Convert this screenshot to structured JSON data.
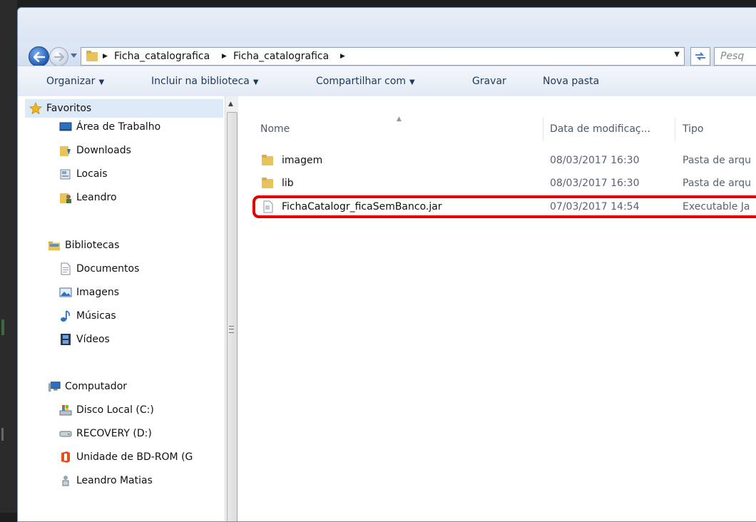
{
  "address": {
    "crumbs": [
      "Ficha_catalografica",
      "Ficha_catalografica"
    ],
    "search_placeholder": "Pesq"
  },
  "toolbar": {
    "organize": "Organizar",
    "include_library": "Incluir na biblioteca",
    "share_with": "Compartilhar com",
    "burn": "Gravar",
    "new_folder": "Nova pasta"
  },
  "nav": {
    "favorites": {
      "label": "Favoritos",
      "items": [
        "Área de Trabalho",
        "Downloads",
        "Locais",
        "Leandro"
      ]
    },
    "libraries": {
      "label": "Bibliotecas",
      "items": [
        "Documentos",
        "Imagens",
        "Músicas",
        "Vídeos"
      ]
    },
    "computer": {
      "label": "Computador",
      "items": [
        "Disco Local (C:)",
        "RECOVERY (D:)",
        "Unidade de BD-ROM (G",
        "Leandro Matias"
      ]
    }
  },
  "columns": {
    "name": "Nome",
    "modified": "Data de modificaç...",
    "type": "Tipo"
  },
  "files": [
    {
      "name": "imagem",
      "modified": "08/03/2017 16:30",
      "type": "Pasta de arqu",
      "icon": "folder-icon"
    },
    {
      "name": "lib",
      "modified": "08/03/2017 16:30",
      "type": "Pasta de arqu",
      "icon": "folder-icon"
    },
    {
      "name": "FichaCatalogr_ficaSemBanco.jar",
      "modified": "07/03/2017 14:54",
      "type": "Executable Ja",
      "icon": "jar-file-icon"
    }
  ],
  "colors": {
    "highlight": "#e00000",
    "folder": "#e8c35a"
  }
}
